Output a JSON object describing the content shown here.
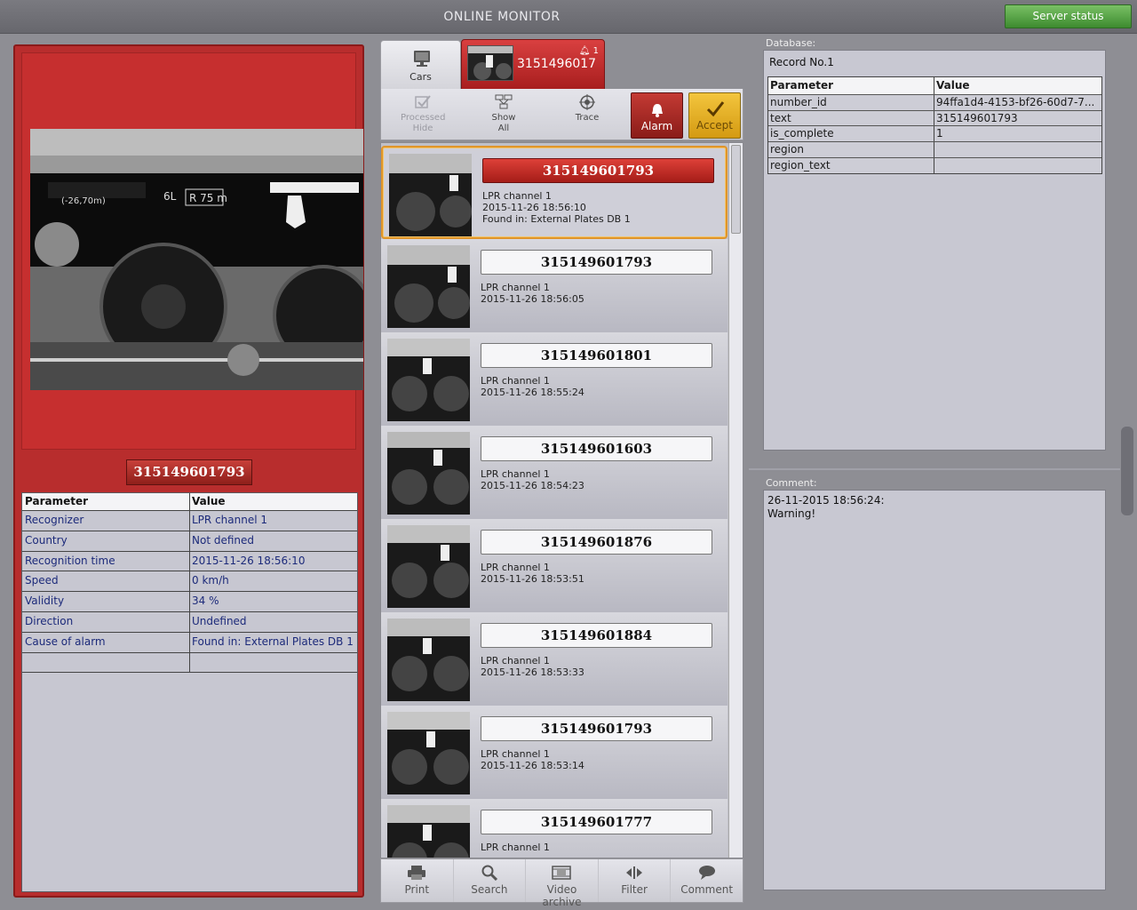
{
  "window": {
    "title": "ONLINE MONITOR",
    "server_status": "Server status"
  },
  "left": {
    "plate": "315149601793",
    "table": {
      "headers": [
        "Parameter",
        "Value"
      ],
      "rows": [
        [
          "Recognizer",
          "LPR channel 1"
        ],
        [
          "Country",
          "Not defined"
        ],
        [
          "Recognition time",
          "2015-11-26 18:56:10"
        ],
        [
          "Speed",
          "0 km/h"
        ],
        [
          "Validity",
          "34 %"
        ],
        [
          "Direction",
          "Undefined"
        ],
        [
          "Cause of alarm",
          "Found in: External Plates DB 1"
        ],
        [
          "",
          ""
        ]
      ]
    }
  },
  "tabs": {
    "cars": "Cars",
    "alarm_number": "3151496017",
    "alarm_count": "1"
  },
  "toolbar": {
    "processed": "Processed",
    "hide": "Hide",
    "show": "Show",
    "all": "All",
    "trace": "Trace",
    "alarm": "Alarm",
    "accept": "Accept"
  },
  "list": [
    {
      "plate": "315149601793",
      "channel": "LPR channel 1",
      "time": "2015-11-26 18:56:10",
      "found": "Found in: External Plates DB 1"
    },
    {
      "plate": "315149601793",
      "channel": "LPR channel 1",
      "time": "2015-11-26 18:56:05",
      "found": ""
    },
    {
      "plate": "315149601801",
      "channel": "LPR channel 1",
      "time": "2015-11-26 18:55:24",
      "found": ""
    },
    {
      "plate": "315149601603",
      "channel": "LPR channel 1",
      "time": "2015-11-26 18:54:23",
      "found": ""
    },
    {
      "plate": "315149601876",
      "channel": "LPR channel 1",
      "time": "2015-11-26 18:53:51",
      "found": ""
    },
    {
      "plate": "315149601884",
      "channel": "LPR channel 1",
      "time": "2015-11-26 18:53:33",
      "found": ""
    },
    {
      "plate": "315149601793",
      "channel": "LPR channel 1",
      "time": "2015-11-26 18:53:14",
      "found": ""
    },
    {
      "plate": "315149601777",
      "channel": "LPR channel 1",
      "time": "",
      "found": ""
    }
  ],
  "bottombar": {
    "print": "Print",
    "search": "Search",
    "video_archive": "Video archive",
    "filter": "Filter",
    "comment": "Comment"
  },
  "database": {
    "label": "Database:",
    "record": "Record No.1",
    "headers": [
      "Parameter",
      "Value"
    ],
    "rows": [
      [
        "number_id",
        "94ffa1d4-4153-bf26-60d7-7..."
      ],
      [
        "text",
        "315149601793"
      ],
      [
        "is_complete",
        "1"
      ],
      [
        "region",
        ""
      ],
      [
        "region_text",
        ""
      ]
    ]
  },
  "comment": {
    "label": "Comment:",
    "line1": "26-11-2015 18:56:24:",
    "line2": "Warning!"
  },
  "colors": {
    "alarm_red": "#b82d2d",
    "accept_yellow": "#e5b22a",
    "server_green": "#4fa03d",
    "selection_orange": "#e0952a"
  }
}
